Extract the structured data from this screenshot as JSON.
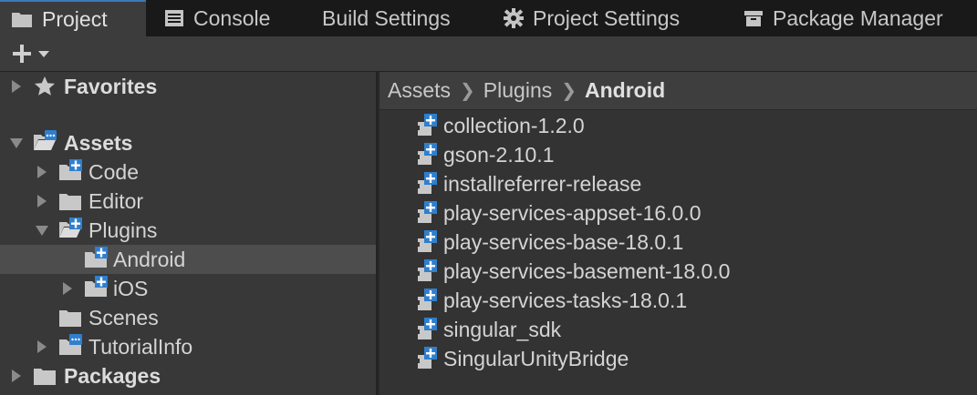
{
  "tabs": [
    {
      "label": "Project",
      "icon": "folder-icon",
      "active": true
    },
    {
      "label": "Console",
      "icon": "console-icon",
      "active": false
    },
    {
      "label": "Build Settings",
      "icon": "",
      "active": false
    },
    {
      "label": "Project Settings",
      "icon": "gear-icon",
      "active": false
    },
    {
      "label": "Package Manager",
      "icon": "package-icon",
      "active": false
    }
  ],
  "toolbar": {
    "create_icon": "plus-icon",
    "dropdown_icon": "chevron-down-icon"
  },
  "tree": [
    {
      "label": "Favorites",
      "icon": "star-icon",
      "arrow": "right",
      "bold": true
    },
    {
      "label": "Assets",
      "icon": "folder-open-icon",
      "arrow": "down",
      "bold": true
    },
    {
      "label": "Code",
      "icon": "folder-plus-icon",
      "arrow": "right"
    },
    {
      "label": "Editor",
      "icon": "folder-icon",
      "arrow": "right"
    },
    {
      "label": "Plugins",
      "icon": "folder-open-plus-icon",
      "arrow": "down"
    },
    {
      "label": "Android",
      "icon": "folder-plus-icon",
      "arrow": "none",
      "selected": true
    },
    {
      "label": "iOS",
      "icon": "folder-plus-icon",
      "arrow": "right"
    },
    {
      "label": "Scenes",
      "icon": "folder-icon",
      "arrow": "none"
    },
    {
      "label": "TutorialInfo",
      "icon": "folder-chat-icon",
      "arrow": "right"
    },
    {
      "label": "Packages",
      "icon": "folder-icon",
      "arrow": "right",
      "bold": true
    }
  ],
  "breadcrumb": [
    "Assets",
    "Plugins",
    "Android"
  ],
  "files": [
    "collection-1.2.0",
    "gson-2.10.1",
    "installreferrer-release",
    "play-services-appset-16.0.0",
    "play-services-base-18.0.1",
    "play-services-basement-18.0.0",
    "play-services-tasks-18.0.1",
    "singular_sdk",
    "SingularUnityBridge"
  ],
  "file_icon": "plugin-icon",
  "colors": {
    "accent": "#3a79bb",
    "badge_blue": "#2f7fcf"
  }
}
